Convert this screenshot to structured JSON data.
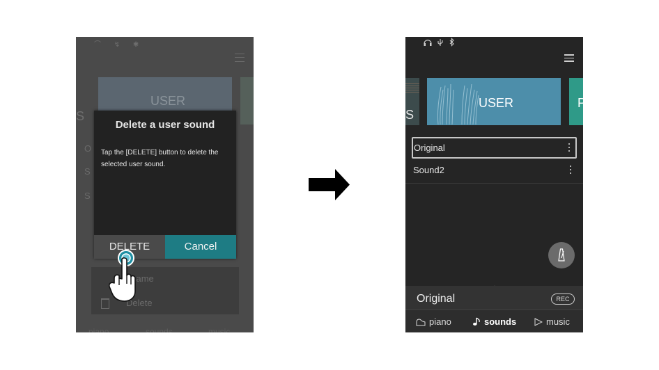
{
  "before": {
    "background": {
      "user_tile_label": "USER",
      "left_tile_fragment": "S",
      "list_fragments": [
        "O",
        "S",
        "S"
      ],
      "context_menu": {
        "rename_label": "ename",
        "delete_label": "Delete"
      },
      "nav": {
        "piano": "piano",
        "sounds": "sounds",
        "music": "music"
      }
    },
    "dialog": {
      "title": "Delete a user sound",
      "body": "Tap the [DELETE] button to delete the selected user sound.",
      "delete_label": "DELETE",
      "cancel_label": "Cancel"
    }
  },
  "after": {
    "status_icons": [
      "headphones-icon",
      "usb-icon",
      "bluetooth-icon"
    ],
    "tiles": {
      "prev_fragment": "S",
      "user_label": "USER",
      "next_fragment": "P"
    },
    "sounds": [
      {
        "name": "Original",
        "selected": true
      },
      {
        "name": "Sound2",
        "selected": false
      }
    ],
    "current_sound": "Original",
    "rec_label": "REC",
    "nav": [
      {
        "label": "piano",
        "icon": "piano-icon",
        "active": false
      },
      {
        "label": "sounds",
        "icon": "music-note-icon",
        "active": true
      },
      {
        "label": "music",
        "icon": "play-icon",
        "active": false
      }
    ]
  },
  "colors": {
    "accent_teal": "#1e7c84",
    "user_tile": "#4d8eaa",
    "dialog_bg": "#222222",
    "app_bg": "#252525"
  }
}
